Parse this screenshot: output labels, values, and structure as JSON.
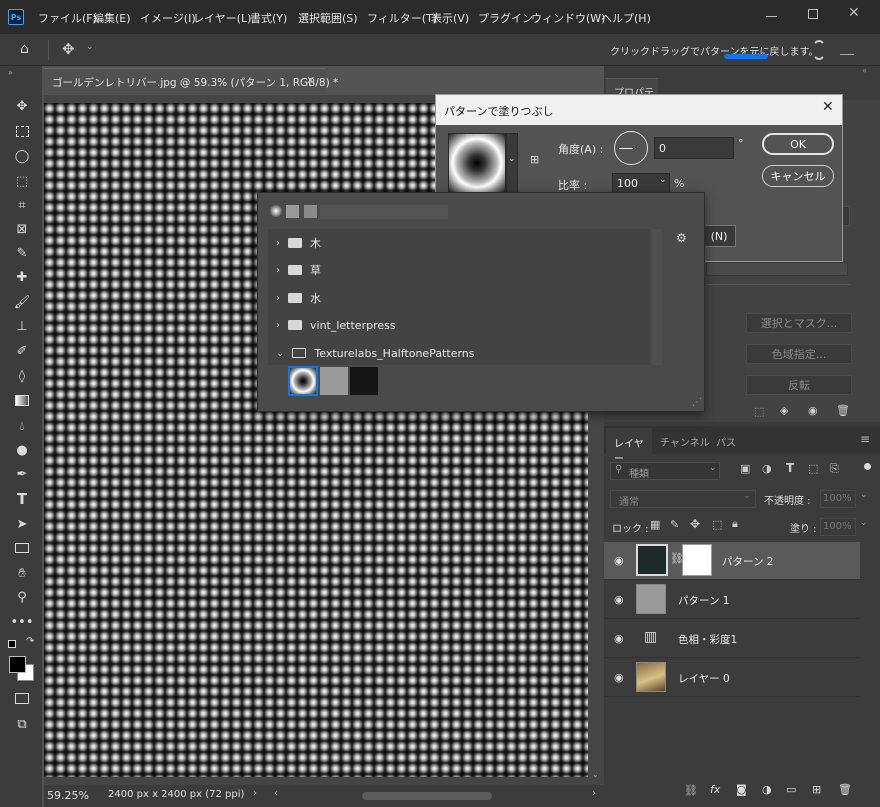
{
  "menubar": {
    "app_icon": "Ps",
    "items": [
      "ファイル(F)",
      "編集(E)",
      "イメージ(I)",
      "レイヤー(L)",
      "書式(Y)",
      "選択範囲(S)",
      "フィルター(T)",
      "表示(V)",
      "プラグイン",
      "ウィンドウ(W)",
      "ヘルプ(H)"
    ]
  },
  "optbar": {
    "hint": "クリックドラッグでパターンを元に戻します。"
  },
  "document": {
    "tab_title": "ゴールデンレトリバー.jpg @ 59.3% (パターン 1, RGB/8) *"
  },
  "statusbar": {
    "zoom": "59.25%",
    "info": "2400 px x 2400 px (72 ppi)"
  },
  "pattern_dialog": {
    "title": "パターンで塗りつぶし",
    "angle_label": "角度(A) :",
    "angle_value": "0",
    "angle_unit": "°",
    "scale_label": "比率 :",
    "scale_value": "100",
    "scale_unit": "%",
    "ok": "OK",
    "cancel": "キャンセル",
    "snap_button": "(N)"
  },
  "pattern_picker": {
    "folders": [
      {
        "name": "木",
        "expanded": false
      },
      {
        "name": "草",
        "expanded": false
      },
      {
        "name": "水",
        "expanded": false
      },
      {
        "name": "vint_letterpress",
        "expanded": false
      },
      {
        "name": "Texturelabs_HalftonePatterns",
        "expanded": true
      }
    ]
  },
  "properties_panel": {
    "tab": "プロパティ",
    "select_mask": "選択とマスク...",
    "color_range": "色域指定...",
    "invert": "反転"
  },
  "layers_panel": {
    "tabs": [
      "レイヤー",
      "チャンネル",
      "パス"
    ],
    "filter_placeholder": "種類",
    "blend_mode": "通常",
    "opacity_label": "不透明度 :",
    "opacity_value": "100%",
    "lock_label": "ロック :",
    "fill_label": "塗り :",
    "fill_value": "100%",
    "layers": [
      {
        "name": "パターン 2",
        "selected": true
      },
      {
        "name": "パターン 1",
        "selected": false
      },
      {
        "name": "色相・彩度1",
        "selected": false
      },
      {
        "name": "レイヤー 0",
        "selected": false
      }
    ]
  },
  "colors": {
    "accent": "#1473e6",
    "selected_layer": "#5a5a5a"
  }
}
